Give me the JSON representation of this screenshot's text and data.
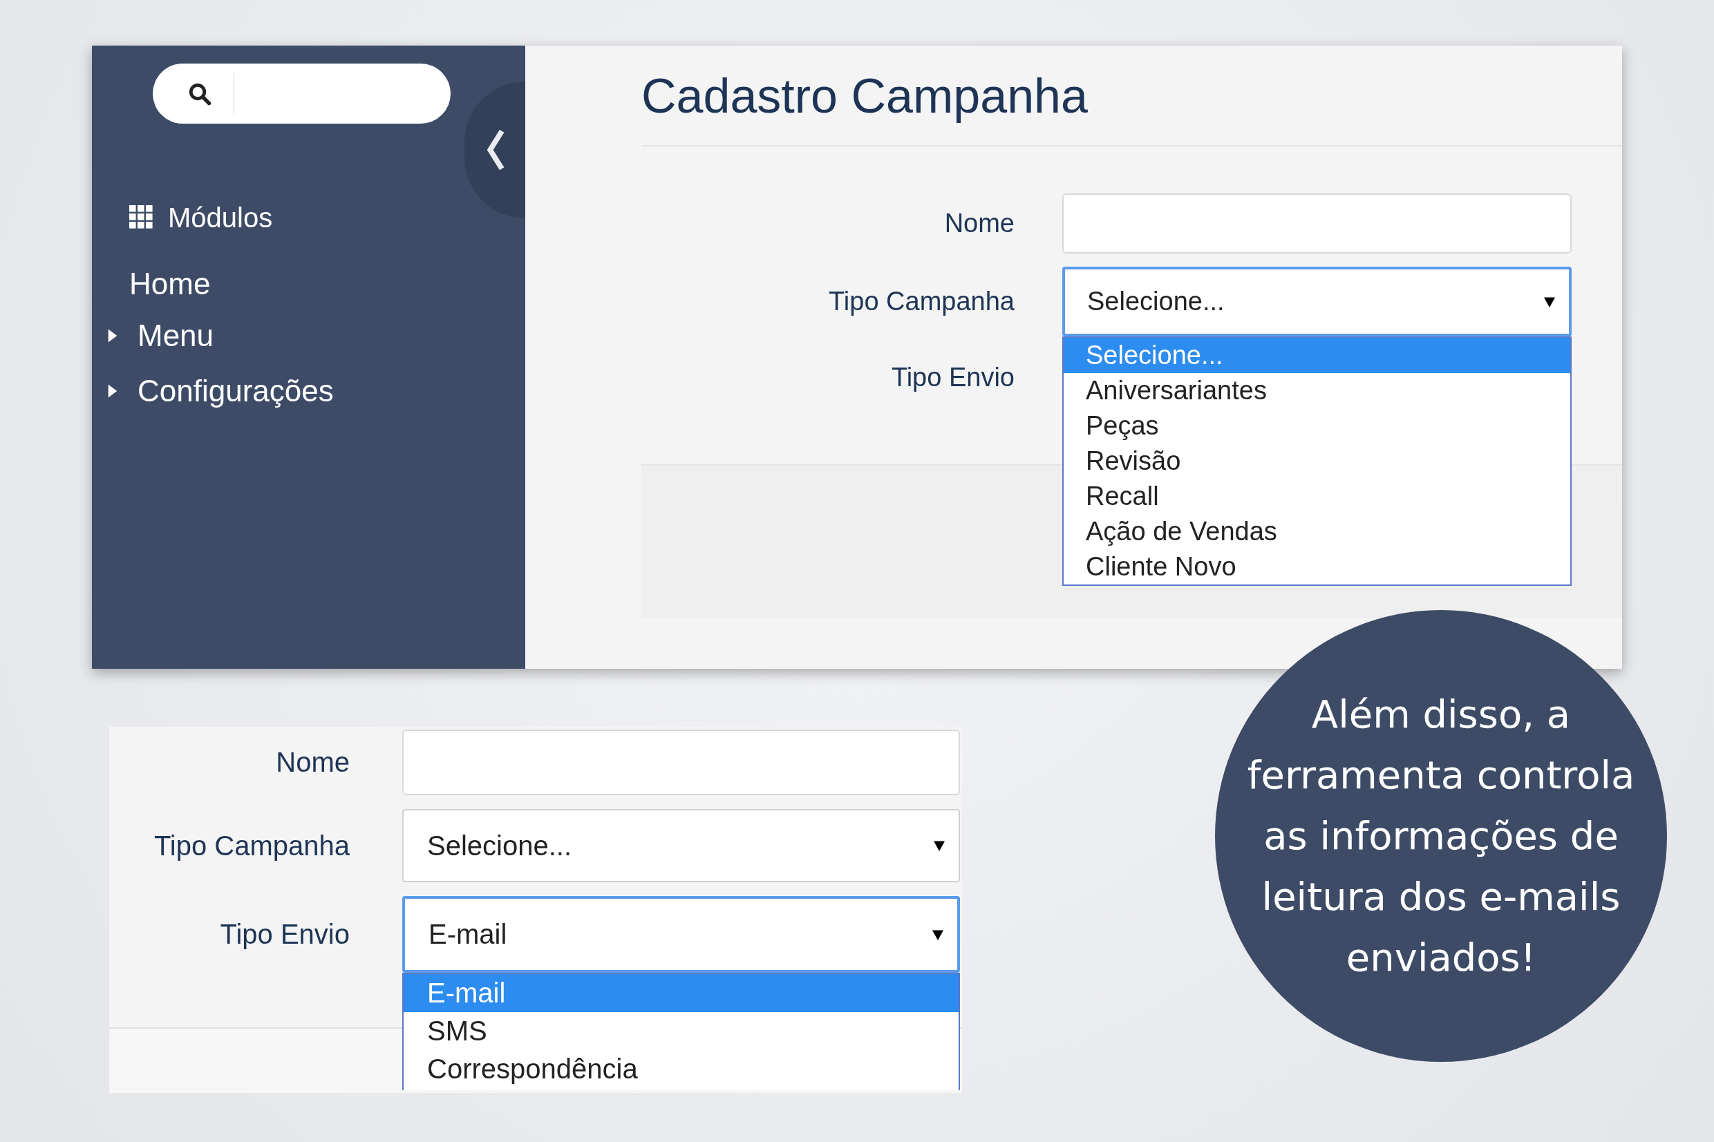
{
  "app_window": {
    "sidebar": {
      "items": [
        {
          "kind": "heading",
          "label": "Módulos"
        },
        {
          "kind": "link",
          "label": "Home"
        },
        {
          "kind": "group",
          "label": "Menu",
          "expanded": false
        },
        {
          "kind": "group",
          "label": "Configurações",
          "expanded": false
        }
      ]
    },
    "title": "Cadastro Campanha",
    "fields": [
      {
        "kind": "text",
        "label": "Nome"
      },
      {
        "kind": "select",
        "label": "Tipo Campanha",
        "value": "Selecione...",
        "open": true,
        "options": [
          {
            "label": "Selecione...",
            "selected": true
          },
          {
            "label": "Aniversariantes",
            "selected": false
          },
          {
            "label": "Peças",
            "selected": false
          },
          {
            "label": "Revisão",
            "selected": false
          },
          {
            "label": "Recall",
            "selected": false
          },
          {
            "label": "Ação de Vendas",
            "selected": false
          },
          {
            "label": "Cliente Novo",
            "selected": false
          }
        ]
      },
      {
        "kind": "covered",
        "label": "Tipo Envio"
      }
    ]
  },
  "form_detail": {
    "fields": [
      {
        "kind": "text",
        "label": "Nome"
      },
      {
        "kind": "select",
        "label": "Tipo Campanha",
        "value": "Selecione...",
        "open": false
      },
      {
        "kind": "select",
        "label": "Tipo Envio",
        "value": "E-mail",
        "open": true,
        "options": [
          {
            "label": "E-mail",
            "selected": true
          },
          {
            "label": "SMS",
            "selected": false
          },
          {
            "label": "Correspondência",
            "selected": false
          }
        ]
      }
    ]
  },
  "callout": {
    "text": "Além disso, a ferramenta controla as informações de leitura dos e-mails enviados!"
  }
}
